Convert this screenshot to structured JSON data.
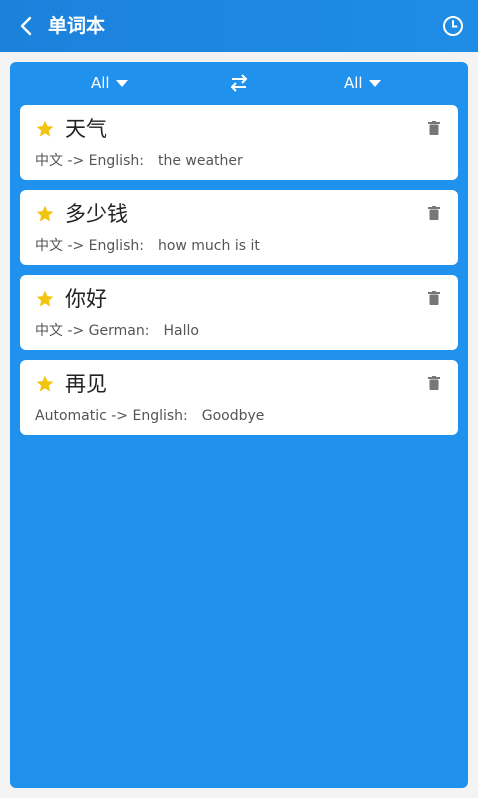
{
  "header": {
    "title": "单词本",
    "back_icon": "chevron-left-icon",
    "history_icon": "clock-icon",
    "bg_color": "#1f8ce6"
  },
  "lang_bar": {
    "from": "All",
    "to": "All",
    "swap_icon": "swap-arrows-icon"
  },
  "panel": {
    "bg_color": "#2191ee"
  },
  "entries": [
    {
      "word": "天气",
      "direction": "中文 -> English:",
      "translation": "the weather",
      "starred": true
    },
    {
      "word": "多少钱",
      "direction": "中文 -> English:",
      "translation": "how much is it",
      "starred": true
    },
    {
      "word": "你好",
      "direction": "中文 -> German:",
      "translation": "Hallo",
      "starred": true
    },
    {
      "word": "再见",
      "direction": "Automatic -> English:",
      "translation": "Goodbye",
      "starred": true
    }
  ],
  "colors": {
    "star": "#f2c40f",
    "trash": "#777777"
  }
}
